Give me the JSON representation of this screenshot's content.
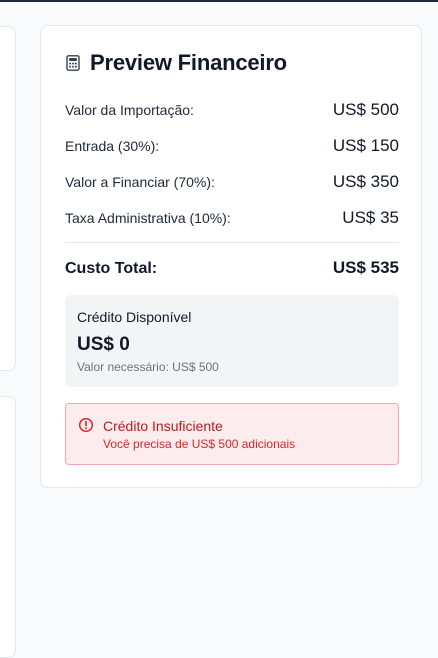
{
  "preview": {
    "icon": "calculator-icon",
    "title": "Preview Financeiro",
    "rows": [
      {
        "label": "Valor da Importação:",
        "value": "US$ 500"
      },
      {
        "label": "Entrada (30%):",
        "value": "US$ 150"
      },
      {
        "label": "Valor a Financiar (70%):",
        "value": "US$ 350"
      },
      {
        "label": "Taxa Administrativa (10%):",
        "value": "US$ 35"
      }
    ],
    "total": {
      "label": "Custo Total:",
      "value": "US$ 535"
    }
  },
  "credit": {
    "title": "Crédito Disponível",
    "amount": "US$ 0",
    "needed": "Valor necessário: US$ 500"
  },
  "alert": {
    "icon": "alert-circle-icon",
    "title": "Crédito Insuficiente",
    "message": "Você precisa de US$ 500 adicionais",
    "color": "#dc2626",
    "background": "#fdecee"
  }
}
